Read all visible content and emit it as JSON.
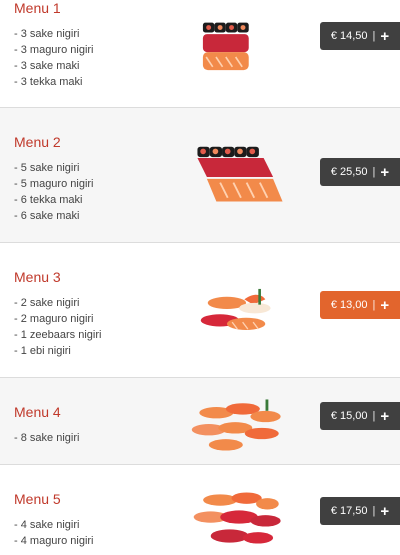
{
  "colors": {
    "title": "#c0392b",
    "button_default": "#404040",
    "button_active": "#e2652d"
  },
  "menus": [
    {
      "title": "Menu 1",
      "items": [
        "3 sake nigiri",
        "3 maguro nigiri",
        "3 sake maki",
        "3 tekka maki"
      ],
      "price": "€ 14,50",
      "active": false
    },
    {
      "title": "Menu 2",
      "items": [
        "5 sake nigiri",
        "5 maguro nigiri",
        "6 tekka maki",
        "6 sake maki"
      ],
      "price": "€ 25,50",
      "active": false
    },
    {
      "title": "Menu 3",
      "items": [
        "2 sake nigiri",
        "2 maguro nigiri",
        "1 zeebaars nigiri",
        "1 ebi nigiri"
      ],
      "price": "€ 13,00",
      "active": true
    },
    {
      "title": "Menu 4",
      "items": [
        "8 sake nigiri"
      ],
      "price": "€ 15,00",
      "active": false
    },
    {
      "title": "Menu 5",
      "items": [
        "4 sake nigiri",
        "4 maguro nigiri"
      ],
      "price": "€ 17,50",
      "active": false
    }
  ],
  "button": {
    "plus_label": "+",
    "separator": "|"
  }
}
